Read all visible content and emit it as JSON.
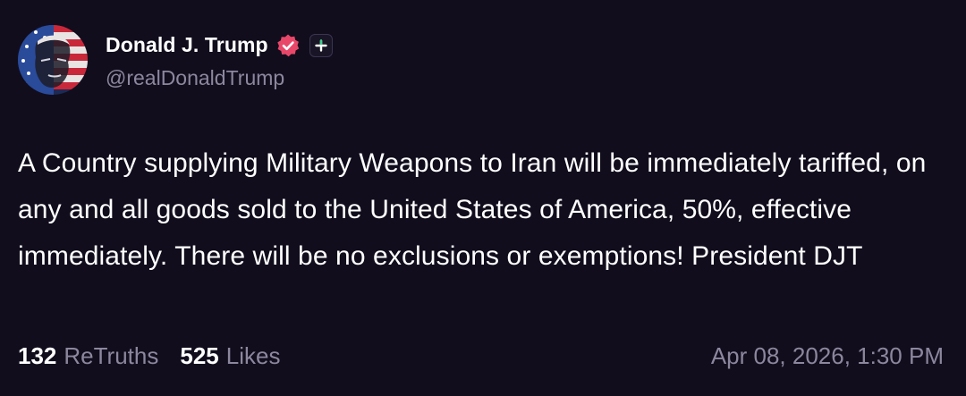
{
  "post": {
    "author": {
      "display_name": "Donald J. Trump",
      "handle": "@realDonaldTrump",
      "verified_icon": "verified-badge-icon",
      "follow_icon": "plus-icon"
    },
    "text": "A Country supplying Military Weapons to Iran will be immediately tariffed, on any and all goods sold to the United States of America, 50%, effective immediately. There will be no exclusions or exemptions! President DJT",
    "stats": {
      "retruths_count": "132",
      "retruths_label": "ReTruths",
      "likes_count": "525",
      "likes_label": "Likes"
    },
    "timestamp": "Apr 08, 2026, 1:30 PM"
  },
  "colors": {
    "background": "#110d1c",
    "primary_text": "#ffffff",
    "secondary_text": "#8d879e",
    "verified_badge": "#e8476a"
  }
}
